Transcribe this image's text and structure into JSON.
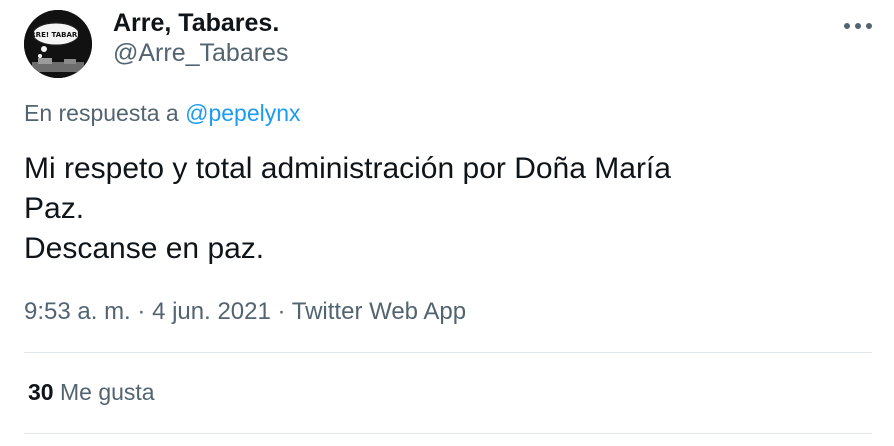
{
  "user": {
    "display_name": "Arre, Tabares.",
    "handle": "@Arre_Tabares",
    "avatar_text": "ARRE! TABARES"
  },
  "more_button_icon": "more-horizontal-icon",
  "reply": {
    "prefix": "En respuesta a",
    "handle": "@pepelynx"
  },
  "tweet": {
    "lines": [
      "Mi respeto y total administración por Doña María",
      "Paz.",
      "Descanse en paz."
    ]
  },
  "meta": {
    "time": "9:53 a. m.",
    "date": "4 jun. 2021",
    "source": "Twitter Web App",
    "separator": "·"
  },
  "stats": {
    "likes_count": "30",
    "likes_label": "Me gusta"
  },
  "colors": {
    "text_primary": "#0f1419",
    "text_secondary": "#536471",
    "link": "#1d9bf0",
    "divider": "#e1e6ea"
  }
}
